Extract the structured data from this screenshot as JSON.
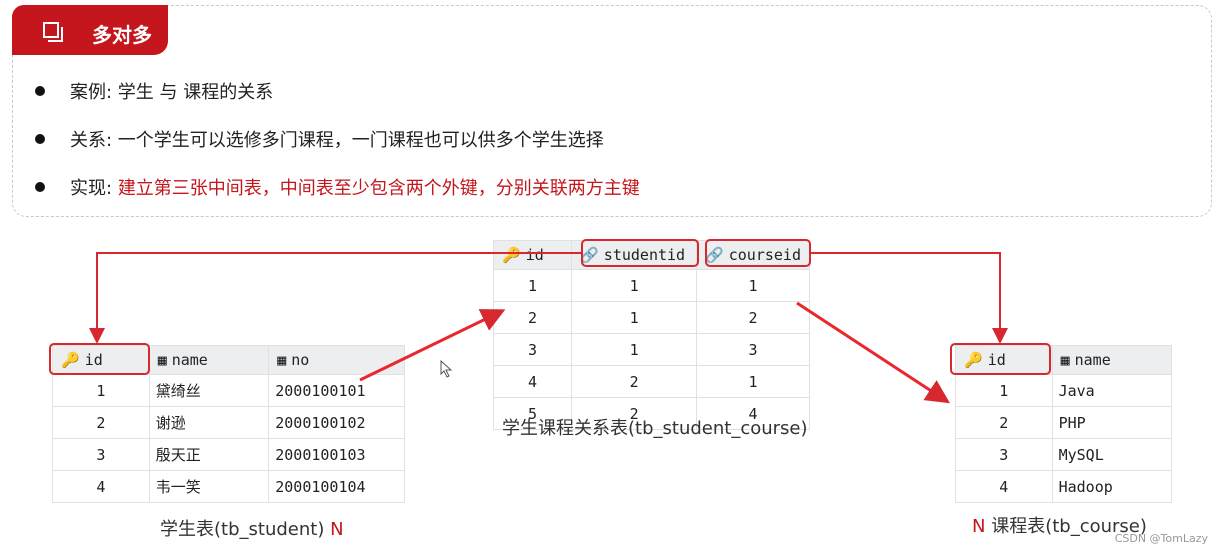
{
  "section": {
    "title": "多对多",
    "icon": "window-copy-icon"
  },
  "bullets": [
    {
      "label": "案例:",
      "text": " 学生 与 课程的关系",
      "highlight": ""
    },
    {
      "label": "关系:",
      "text": " 一个学生可以选修多门课程，一门课程也可以供多个学生选择",
      "highlight": ""
    },
    {
      "label": "实现:",
      "text": " ",
      "highlight": "建立第三张中间表，中间表至少包含两个外键，分别关联两方主键"
    }
  ],
  "student_table": {
    "columns": [
      "id",
      "name",
      "no"
    ],
    "rows": [
      [
        "1",
        "黛绮丝",
        "2000100101"
      ],
      [
        "2",
        "谢逊",
        "2000100102"
      ],
      [
        "3",
        "殷天正",
        "2000100103"
      ],
      [
        "4",
        "韦一笑",
        "2000100104"
      ]
    ],
    "caption": "学生表(tb_student)",
    "multiplicity": "N"
  },
  "link_table": {
    "columns": [
      "id",
      "studentid",
      "courseid"
    ],
    "rows": [
      [
        "1",
        "1",
        "1"
      ],
      [
        "2",
        "1",
        "2"
      ],
      [
        "3",
        "1",
        "3"
      ],
      [
        "4",
        "2",
        "1"
      ],
      [
        "5",
        "2",
        "4"
      ]
    ],
    "caption": "学生课程关系表(tb_student_course)"
  },
  "course_table": {
    "columns": [
      "id",
      "name"
    ],
    "rows": [
      [
        "1",
        "Java"
      ],
      [
        "2",
        "PHP"
      ],
      [
        "3",
        "MySQL"
      ],
      [
        "4",
        "Hadoop"
      ]
    ],
    "caption": "课程表(tb_course)",
    "multiplicity": "N"
  },
  "watermark": "CSDN @TomLazy",
  "colors": {
    "accent": "#c4161c",
    "header_bg": "#eceef0",
    "border": "#e1e1e1"
  }
}
